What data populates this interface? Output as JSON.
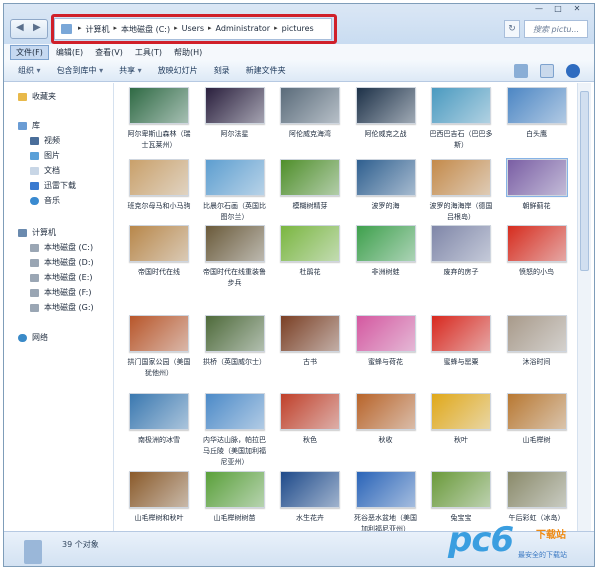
{
  "address": {
    "crumbs": [
      "计算机",
      "本地磁盘 (C:)",
      "Users",
      "Administrator",
      "pictures"
    ],
    "search_placeholder": "搜索 pictu..."
  },
  "menu": [
    "文件(F)",
    "编辑(E)",
    "查看(V)",
    "工具(T)",
    "帮助(H)"
  ],
  "toolbar": {
    "organize": "组织",
    "include": "包含到库中",
    "share": "共享",
    "slideshow": "放映幻灯片",
    "burn": "刻录",
    "new_folder": "新建文件夹"
  },
  "sidebar": {
    "favorites": "收藏夹",
    "library": "库",
    "video": "视频",
    "pictures": "图片",
    "docs": "文档",
    "xunlei": "迅雷下载",
    "music": "音乐",
    "computer": "计算机",
    "drive_c": "本地磁盘 (C:)",
    "drive_d": "本地磁盘 (D:)",
    "drive_e": "本地磁盘 (E:)",
    "drive_f": "本地磁盘 (F:)",
    "drive_g": "本地磁盘 (G:)",
    "network": "网络"
  },
  "files": [
    {
      "name": "阿尔卑斯山森林（瑞士瓦莱州）",
      "color": "#2f6a44"
    },
    {
      "name": "阿尔法星",
      "color": "#2a1f3d"
    },
    {
      "name": "阿伦威克海湾",
      "color": "#5a6b7a"
    },
    {
      "name": "阿伦威克之战",
      "color": "#1d3148"
    },
    {
      "name": "巴西巴吉石（巴巴多斯）",
      "color": "#4a9ac0"
    },
    {
      "name": "白头鹰",
      "color": "#4c86c4"
    },
    {
      "name": "班克尔母马和小马驹",
      "color": "#c9a06a"
    },
    {
      "name": "比晨尔石画（英国比图尔兰）",
      "color": "#5d9ed0"
    },
    {
      "name": "模糊树精芽",
      "color": "#4f8f2a"
    },
    {
      "name": "波罗的海",
      "color": "#2f5f8f"
    },
    {
      "name": "波罗的海海岸（德国吕根岛）",
      "color": "#c48a4a"
    },
    {
      "name": "朝鲜蓟花",
      "color": "#7a5ea4"
    },
    {
      "name": "帝国时代在线",
      "color": "#b8874a"
    },
    {
      "name": "帝国时代在线重装鲁步兵",
      "color": "#6a5a3a"
    },
    {
      "name": "杜鹃花",
      "color": "#7ab640"
    },
    {
      "name": "非洲树蛙",
      "color": "#3ea04c"
    },
    {
      "name": "废弃的房子",
      "color": "#7f86a8"
    },
    {
      "name": "愤怒的小鸟",
      "color": "#d62c1e"
    },
    {
      "name": "拱门国家公园（美国犹他州）",
      "color": "#b8562a"
    },
    {
      "name": "拱桥（英国威尔士）",
      "color": "#4e6a3a"
    },
    {
      "name": "古书",
      "color": "#7a3f24"
    },
    {
      "name": "蜜蜂与荷花",
      "color": "#d458a0"
    },
    {
      "name": "蜜蜂与罂粟",
      "color": "#d8281e"
    },
    {
      "name": "沐浴时间",
      "color": "#a89a8a"
    },
    {
      "name": "南极洲的冰雪",
      "color": "#3a78b0"
    },
    {
      "name": "内华达山脉，帕拉巴马丘陵（美国加利福尼亚州）",
      "color": "#4c8ac8"
    },
    {
      "name": "秋色",
      "color": "#c0402a"
    },
    {
      "name": "秋收",
      "color": "#b8642a"
    },
    {
      "name": "秋叶",
      "color": "#e0a81a"
    },
    {
      "name": "山毛榉树",
      "color": "#b87832"
    },
    {
      "name": "山毛榉树和秋叶",
      "color": "#8a5a2a"
    },
    {
      "name": "山毛榉树树苗",
      "color": "#5aa03a"
    },
    {
      "name": "水生花卉",
      "color": "#1e4a8a"
    },
    {
      "name": "死谷恶水盆地（美国加利福尼亚州）",
      "color": "#2a64b8"
    },
    {
      "name": "兔宝宝",
      "color": "#6a9a3a"
    },
    {
      "name": "午后彩虹（冰岛）",
      "color": "#8a8a6a"
    }
  ],
  "status": "39 个对象",
  "watermark": {
    "logo": "pc6",
    "sub1": "下载站",
    "sub2": "最安全的下载站"
  }
}
